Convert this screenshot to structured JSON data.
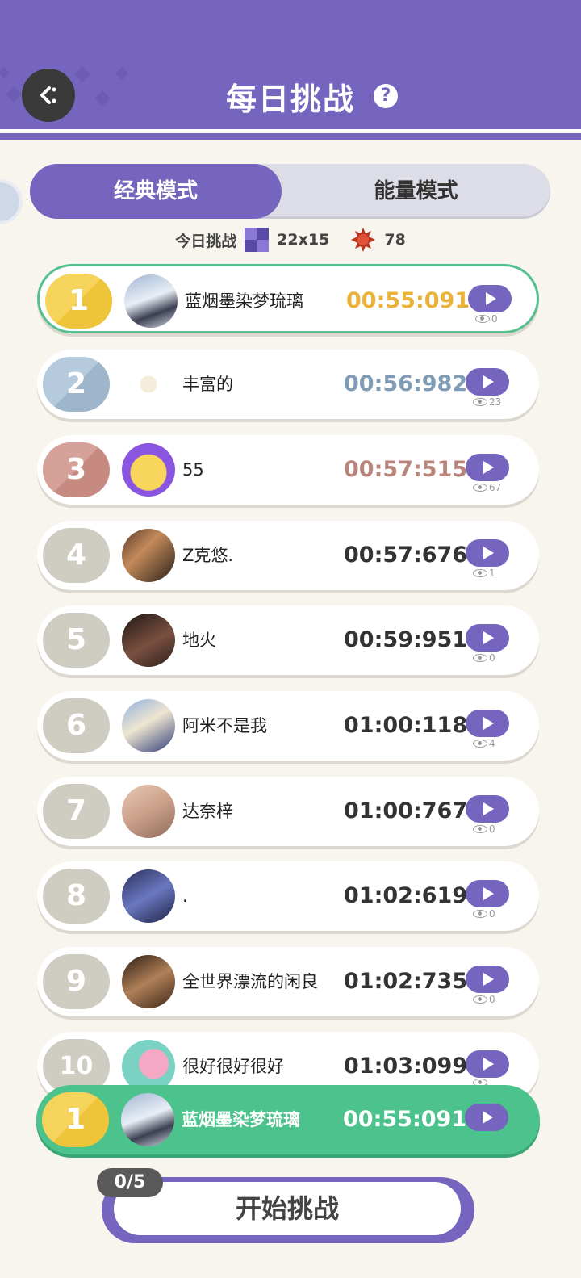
{
  "header": {
    "title": "每日挑战",
    "help_icon": "?"
  },
  "tabs": [
    {
      "label": "经典模式",
      "active": true
    },
    {
      "label": "能量模式",
      "active": false
    }
  ],
  "info": {
    "label": "今日挑战",
    "grid_size": "22x15",
    "energy": "78"
  },
  "colors": {
    "accent": "#7665be",
    "green": "#4cc38c",
    "gold": "#f2c342",
    "silver": "#a8bfd4",
    "bronze": "#c98f86",
    "gray": "#cfccc2"
  },
  "leaderboard": [
    {
      "rank": "1",
      "name": "蓝烟墨染梦琉璃",
      "time": "00:55:091",
      "views": "0"
    },
    {
      "rank": "2",
      "name": "丰富的",
      "time": "00:56:982",
      "views": "23"
    },
    {
      "rank": "3",
      "name": "55",
      "time": "00:57:515",
      "views": "67"
    },
    {
      "rank": "4",
      "name": "Z克悠.",
      "time": "00:57:676",
      "views": "1"
    },
    {
      "rank": "5",
      "name": "地火",
      "time": "00:59:951",
      "views": "0"
    },
    {
      "rank": "6",
      "name": "阿米不是我",
      "time": "01:00:118",
      "views": "4"
    },
    {
      "rank": "7",
      "name": "达奈梓",
      "time": "01:00:767",
      "views": "0"
    },
    {
      "rank": "8",
      "name": ".",
      "time": "01:02:619",
      "views": "0"
    },
    {
      "rank": "9",
      "name": "全世界漂流的闲良",
      "time": "01:02:735",
      "views": "0"
    },
    {
      "rank": "10",
      "name": "很好很好很好",
      "time": "01:03:099",
      "views": ""
    }
  ],
  "self": {
    "rank": "1",
    "name": "蓝烟墨染梦琉璃",
    "time": "00:55:091"
  },
  "start": {
    "label": "开始挑战",
    "counter": "0/5"
  }
}
